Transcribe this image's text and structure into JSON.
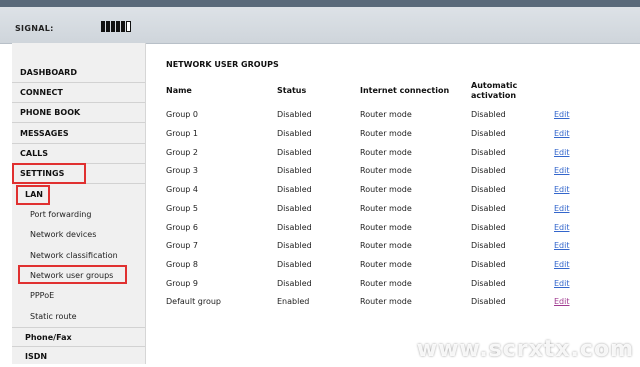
{
  "header": {
    "signal_label": "SIGNAL:",
    "signal_level": "5 of 6 bars"
  },
  "sidebar": {
    "items": [
      {
        "label": "DASHBOARD"
      },
      {
        "label": "CONNECT"
      },
      {
        "label": "PHONE BOOK"
      },
      {
        "label": "MESSAGES"
      },
      {
        "label": "CALLS"
      },
      {
        "label": "SETTINGS"
      },
      {
        "label": "LAN"
      }
    ],
    "lan_sub": [
      {
        "label": "Port forwarding"
      },
      {
        "label": "Network devices"
      },
      {
        "label": "Network classification"
      },
      {
        "label": "Network user groups"
      },
      {
        "label": "PPPoE"
      },
      {
        "label": "Static route"
      }
    ],
    "bottom": [
      {
        "label": "Phone/Fax"
      },
      {
        "label": "ISDN"
      }
    ]
  },
  "main": {
    "title": "NETWORK USER GROUPS",
    "columns": {
      "name": "Name",
      "status": "Status",
      "internet": "Internet connection",
      "auto": "Automatic activation"
    },
    "rows": [
      {
        "name": "Group 0",
        "status": "Disabled",
        "internet": "Router mode",
        "auto": "Disabled",
        "action": "Edit"
      },
      {
        "name": "Group 1",
        "status": "Disabled",
        "internet": "Router mode",
        "auto": "Disabled",
        "action": "Edit"
      },
      {
        "name": "Group 2",
        "status": "Disabled",
        "internet": "Router mode",
        "auto": "Disabled",
        "action": "Edit"
      },
      {
        "name": "Group 3",
        "status": "Disabled",
        "internet": "Router mode",
        "auto": "Disabled",
        "action": "Edit"
      },
      {
        "name": "Group 4",
        "status": "Disabled",
        "internet": "Router mode",
        "auto": "Disabled",
        "action": "Edit"
      },
      {
        "name": "Group 5",
        "status": "Disabled",
        "internet": "Router mode",
        "auto": "Disabled",
        "action": "Edit"
      },
      {
        "name": "Group 6",
        "status": "Disabled",
        "internet": "Router mode",
        "auto": "Disabled",
        "action": "Edit"
      },
      {
        "name": "Group 7",
        "status": "Disabled",
        "internet": "Router mode",
        "auto": "Disabled",
        "action": "Edit"
      },
      {
        "name": "Group 8",
        "status": "Disabled",
        "internet": "Router mode",
        "auto": "Disabled",
        "action": "Edit"
      },
      {
        "name": "Group 9",
        "status": "Disabled",
        "internet": "Router mode",
        "auto": "Disabled",
        "action": "Edit"
      },
      {
        "name": "Default group",
        "status": "Enabled",
        "internet": "Router mode",
        "auto": "Disabled",
        "action": "Edit"
      }
    ]
  },
  "watermark": "www.scrxtx.com"
}
